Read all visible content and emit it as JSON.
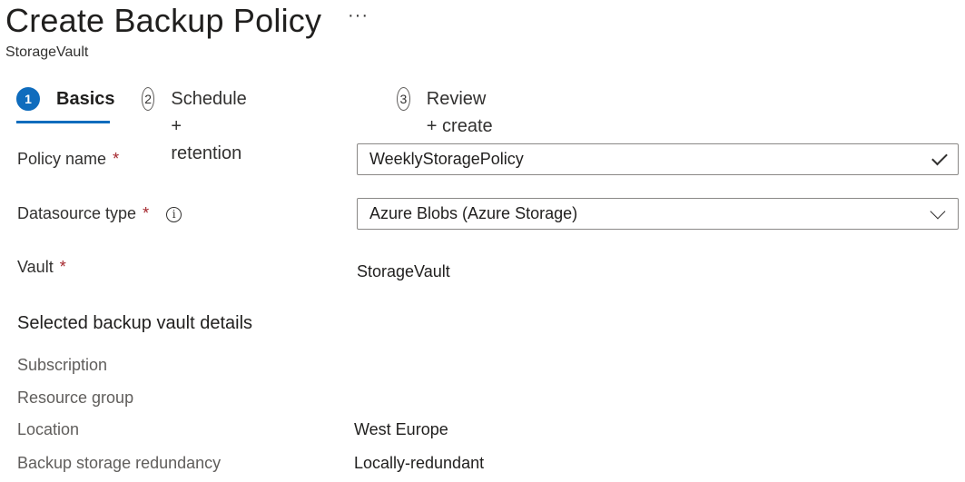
{
  "header": {
    "title": "Create Backup Policy",
    "more_label": "···",
    "subtitle": "StorageVault"
  },
  "steps": [
    {
      "number": "1",
      "label": "Basics",
      "active": true
    },
    {
      "number": "2",
      "label": "Schedule + retention",
      "active": false
    },
    {
      "number": "3",
      "label": "Review + create",
      "active": false
    }
  ],
  "form": {
    "policy_name": {
      "label": "Policy name",
      "required": "*",
      "value": "WeeklyStoragePolicy",
      "status_icon": "checkmark-icon"
    },
    "datasource_type": {
      "label": "Datasource type",
      "required": "*",
      "info_icon": "i",
      "value": "Azure Blobs (Azure Storage)",
      "icon": "chevron-down-icon"
    },
    "vault": {
      "label": "Vault",
      "required": "*",
      "value": "StorageVault"
    }
  },
  "vault_details": {
    "heading": "Selected backup vault details",
    "rows": [
      {
        "label": "Subscription",
        "value": ""
      },
      {
        "label": "Resource group",
        "value": ""
      },
      {
        "label": "Location",
        "value": "West Europe"
      },
      {
        "label": "Backup storage redundancy",
        "value": "Locally-redundant"
      }
    ]
  },
  "colors": {
    "accent": "#0f6cbd",
    "required": "#a4262c",
    "text": "#323130",
    "border": "#8a8886"
  }
}
